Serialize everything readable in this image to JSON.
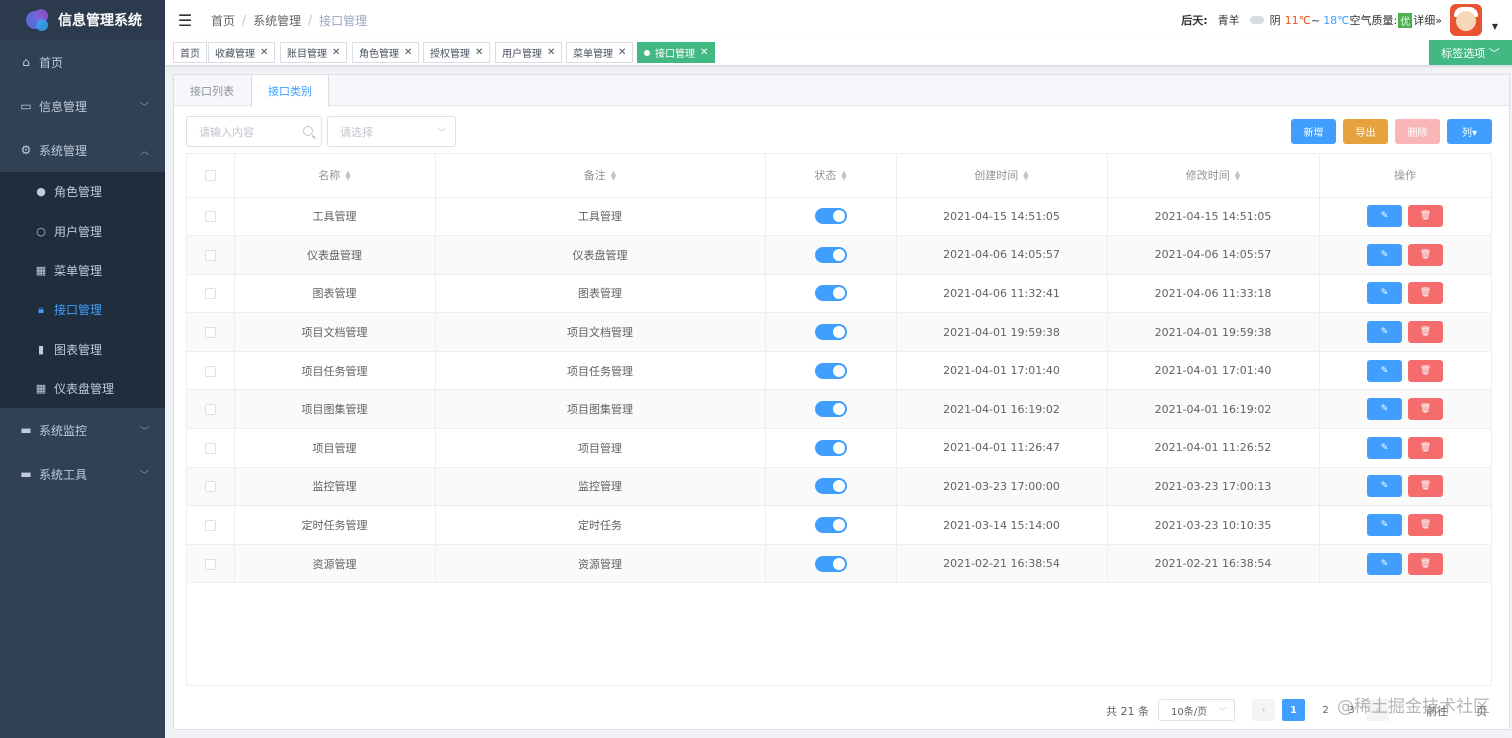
{
  "app": {
    "title": "信息管理系统"
  },
  "sidebar": {
    "items": [
      {
        "label": "首页",
        "icon": "home-icon"
      },
      {
        "label": "信息管理",
        "icon": "archive-icon"
      },
      {
        "label": "系统管理",
        "icon": "gear-icon"
      }
    ],
    "system_sub": [
      {
        "label": "角色管理",
        "icon": "user-icon"
      },
      {
        "label": "用户管理",
        "icon": "user-outline-icon"
      },
      {
        "label": "菜单管理",
        "icon": "grid-icon"
      },
      {
        "label": "接口管理",
        "icon": "lock-icon",
        "active": true
      },
      {
        "label": "图表管理",
        "icon": "bar-chart-icon"
      },
      {
        "label": "仪表盘管理",
        "icon": "dashboard-grid-icon"
      }
    ],
    "more": [
      {
        "label": "系统监控",
        "icon": "monitor-icon"
      },
      {
        "label": "系统工具",
        "icon": "toolbox-icon"
      }
    ]
  },
  "header": {
    "breadcrumb": [
      "首页",
      "系统管理",
      "接口管理"
    ],
    "weather": {
      "day": "后天:",
      "city": "青羊",
      "condition": "阴",
      "high": "11℃",
      "tilde": "~",
      "low": "18℃",
      "aq_label": "空气质量:",
      "aq_value": "优",
      "detail": "详细»"
    }
  },
  "tags": {
    "items": [
      "首页",
      "收藏管理",
      "账目管理",
      "角色管理",
      "授权管理",
      "用户管理",
      "菜单管理",
      "接口管理"
    ],
    "options_label": "标签选项"
  },
  "tabs": [
    "接口列表",
    "接口类别"
  ],
  "toolbar": {
    "search_placeholder": "请输入内容",
    "select_placeholder": "请选择",
    "add": "新增",
    "export": "导出",
    "delete": "删除",
    "columns": "列▾"
  },
  "table": {
    "headers": [
      "名称",
      "备注",
      "状态",
      "创建时间",
      "修改时间",
      "操作"
    ],
    "rows": [
      {
        "name": "工具管理",
        "note": "工具管理",
        "created": "2021-04-15 14:51:05",
        "modified": "2021-04-15 14:51:05",
        "enabled": true
      },
      {
        "name": "仪表盘管理",
        "note": "仪表盘管理",
        "created": "2021-04-06 14:05:57",
        "modified": "2021-04-06 14:05:57",
        "enabled": true
      },
      {
        "name": "图表管理",
        "note": "图表管理",
        "created": "2021-04-06 11:32:41",
        "modified": "2021-04-06 11:33:18",
        "enabled": true
      },
      {
        "name": "项目文档管理",
        "note": "项目文档管理",
        "created": "2021-04-01 19:59:38",
        "modified": "2021-04-01 19:59:38",
        "enabled": true
      },
      {
        "name": "项目任务管理",
        "note": "项目任务管理",
        "created": "2021-04-01 17:01:40",
        "modified": "2021-04-01 17:01:40",
        "enabled": true
      },
      {
        "name": "项目图集管理",
        "note": "项目图集管理",
        "created": "2021-04-01 16:19:02",
        "modified": "2021-04-01 16:19:02",
        "enabled": true
      },
      {
        "name": "项目管理",
        "note": "项目管理",
        "created": "2021-04-01 11:26:47",
        "modified": "2021-04-01 11:26:52",
        "enabled": true
      },
      {
        "name": "监控管理",
        "note": "监控管理",
        "created": "2021-03-23 17:00:00",
        "modified": "2021-03-23 17:00:13",
        "enabled": true
      },
      {
        "name": "定时任务管理",
        "note": "定时任务",
        "created": "2021-03-14 15:14:00",
        "modified": "2021-03-23 10:10:35",
        "enabled": true
      },
      {
        "name": "资源管理",
        "note": "资源管理",
        "created": "2021-02-21 16:38:54",
        "modified": "2021-02-21 16:38:54",
        "enabled": true
      }
    ]
  },
  "pagination": {
    "total": "共 21 条",
    "page_size": "10条/页",
    "pages": [
      "1",
      "2",
      "3"
    ],
    "current": "1",
    "prev": "‹",
    "next": "›",
    "goto": "前往",
    "page_unit": "页"
  },
  "watermark": "@稀土掘金技术社区",
  "colors": {
    "primary": "#409eff",
    "success": "#42b983",
    "warning": "#e6a23c",
    "danger": "#f56c6c",
    "sidebar": "#304156"
  }
}
